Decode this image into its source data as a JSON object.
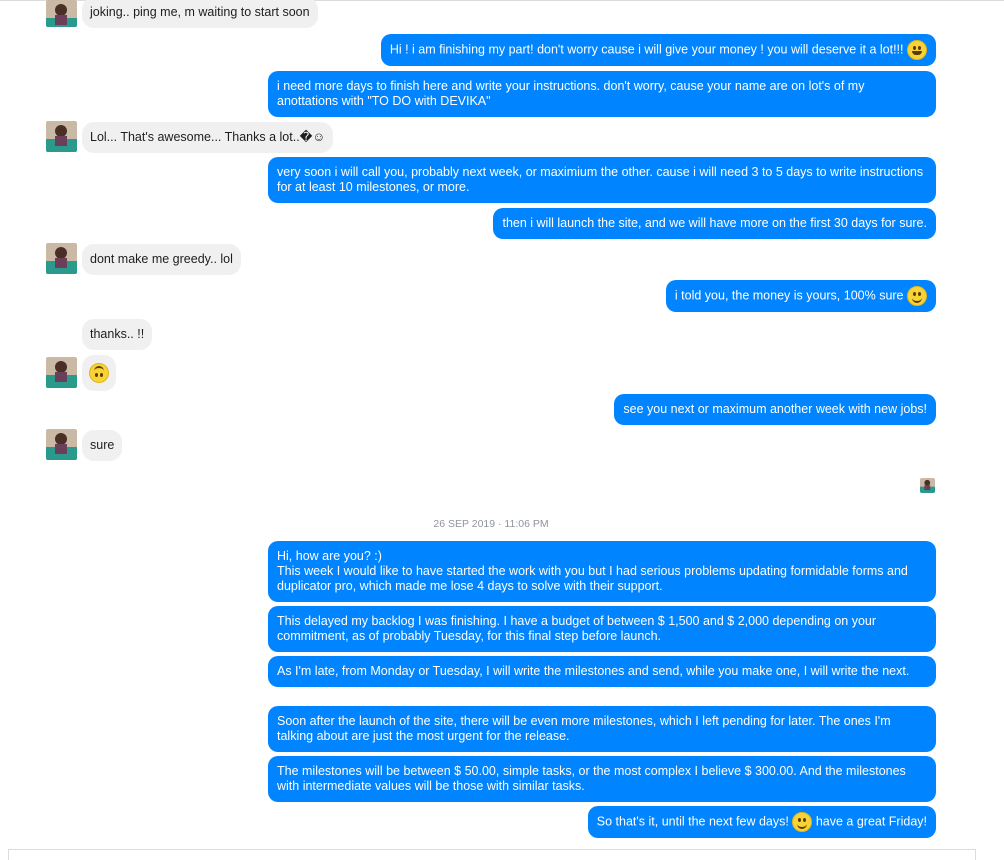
{
  "timestamp": "26 SEP 2019 · 11:06 PM",
  "messages": {
    "m1": "joking.. ping me, m waiting to start soon",
    "m2": "Hi ! i am finishing my part! don't worry cause i will give your money ! you will deserve it a lot!!!",
    "m3": "i need more days to finish here and write your instructions. don't worry, cause your name are on lot's of my anottations with \"TO DO with DEVIKA\"",
    "m4": "Lol... That's awesome... Thanks a lot..�☺",
    "m5": "very soon i will call you, probably next week, or maximium the other. cause i will need 3 to 5 days to write instructions for at least 10 milestones, or more.",
    "m6": "then i will launch the site, and we will have more on the first 30 days for sure.",
    "m7": "dont make me greedy.. lol",
    "m8": "i told you, the money is yours, 100% sure",
    "m9": "thanks.. !!",
    "m10": "sure",
    "m11": "see you next or maximum another week with new jobs!",
    "m12_line1": "Hi, how are you? :)",
    "m12_line2": "This week I would like to have started the work with you but I had serious problems updating formidable forms and duplicator pro, which made me lose 4 days to solve with their support.",
    "m13": "This delayed my backlog I was finishing. I have a budget of between $ 1,500 and $ 2,000 depending on your commitment, as of probably Tuesday, for this final step before launch.",
    "m14": "As I'm late, from Monday or Tuesday, I will write the milestones and send, while you make one, I will write the next.",
    "m15": "Soon after the launch of the site, there will be even more milestones, which I left pending for later. The ones I'm talking about are just the most urgent for the release.",
    "m16": "The milestones will be between $ 50.00, simple tasks, or the most complex I believe $ 300.00. And the milestones with intermediate values will be those with similar tasks.",
    "m17_part1": "So that's it, until the next few days!",
    "m17_part2": "have a great Friday!"
  },
  "colors": {
    "outgoing": "#0084ff",
    "incoming": "#f1f0f0",
    "accent": "#0084ff"
  },
  "icons": {
    "smile": "smile-emoji",
    "grin": "grin-emoji",
    "upside": "upside-down-emoji"
  }
}
